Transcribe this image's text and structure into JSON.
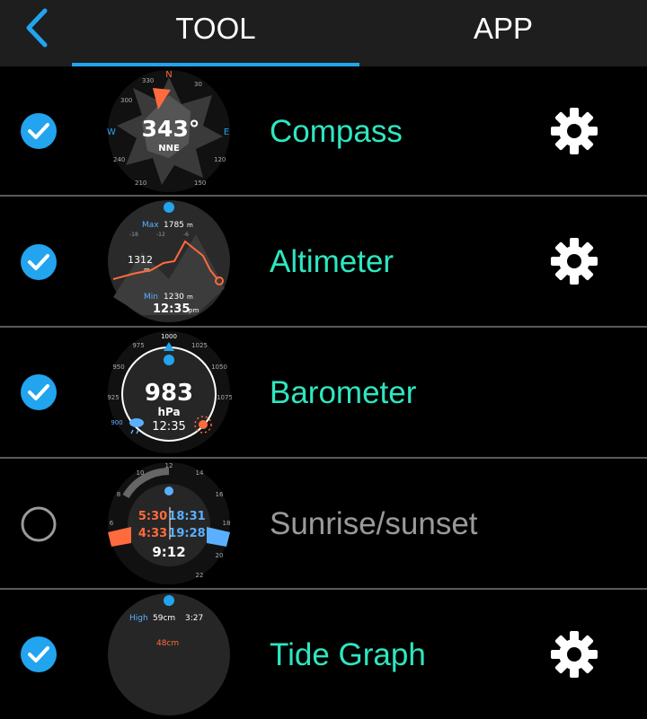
{
  "header": {
    "tabs": [
      {
        "label": "TOOL",
        "active": true
      },
      {
        "label": "APP",
        "active": false
      }
    ],
    "accent_color": "#22a4ef"
  },
  "colors": {
    "enabled_label": "#2ee6c0",
    "disabled_label": "#9a9a9a",
    "check_blue": "#22a4ef"
  },
  "tools": [
    {
      "label": "Compass",
      "enabled": true,
      "has_settings": true,
      "face": {
        "heading": "343°",
        "direction": "NNE",
        "north": "N",
        "east": "E",
        "west": "W",
        "ticks": [
          "330",
          "300",
          "30",
          "120",
          "150",
          "210",
          "240"
        ]
      }
    },
    {
      "label": "Altimeter",
      "enabled": true,
      "has_settings": true,
      "face": {
        "max_label": "Max",
        "max_value": "1785",
        "max_unit": "m",
        "current": "1312",
        "current_unit": "m",
        "min_label": "Min",
        "min_value": "1230",
        "min_unit": "m",
        "time": "12:35",
        "ampm": "pm",
        "axis": [
          "-18",
          "-12",
          "-6"
        ]
      }
    },
    {
      "label": "Barometer",
      "enabled": true,
      "has_settings": false,
      "face": {
        "value": "983",
        "unit": "hPa",
        "time": "12:35",
        "ticks": [
          "1000",
          "975",
          "1025",
          "950",
          "1050",
          "925",
          "1075",
          "900"
        ]
      }
    },
    {
      "label": "Sunrise/sunset",
      "enabled": false,
      "has_settings": false,
      "face": {
        "sunrise": "5:30",
        "sunset": "18:31",
        "dawn": "4:33",
        "dusk": "19:28",
        "daylight": "9:12",
        "hours": [
          "10",
          "12",
          "14",
          "16",
          "18",
          "20",
          "22",
          "8",
          "6"
        ]
      }
    },
    {
      "label": "Tide Graph",
      "enabled": true,
      "has_settings": true,
      "face": {
        "high_label": "High",
        "high_value": "59cm",
        "high_time": "3:27",
        "current": "48cm"
      }
    }
  ]
}
